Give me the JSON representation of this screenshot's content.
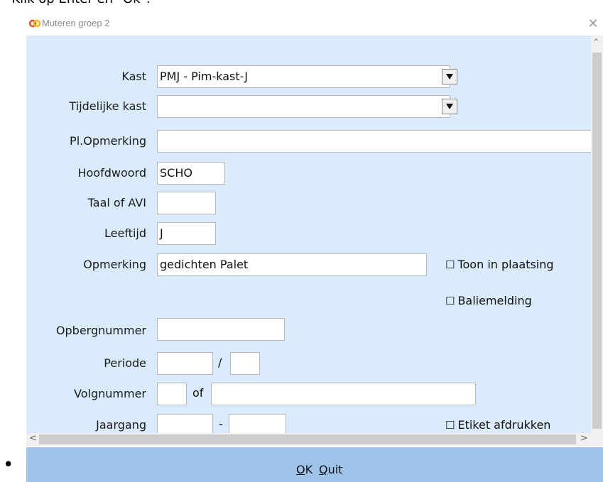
{
  "instruction": {
    "text": "Klik op Enter en \"Ok\"."
  },
  "window": {
    "title": "Muteren groep 2",
    "close_glyph": "✕"
  },
  "form": {
    "kast": {
      "label": "Kast",
      "value": "PMJ - Pim-kast-J"
    },
    "tijdelijke_kast": {
      "label": "Tijdelijke kast",
      "value": ""
    },
    "pl_opmerking": {
      "label": "Pl.Opmerking",
      "value": ""
    },
    "hoofdwoord": {
      "label": "Hoofdwoord",
      "value": "SCHO"
    },
    "taal_of_avi": {
      "label": "Taal of AVI",
      "value": ""
    },
    "leeftijd": {
      "label": "Leeftijd",
      "value": "J"
    },
    "opmerking": {
      "label": "Opmerking",
      "value": "gedichten Palet"
    },
    "toon_in_plaatsing": {
      "label": "Toon in plaatsing",
      "checked": false
    },
    "baliemelding": {
      "label": "Baliemelding",
      "checked": false
    },
    "opbergnummer": {
      "label": "Opbergnummer",
      "value": ""
    },
    "periode": {
      "label": "Periode",
      "value1": "",
      "separator": "/",
      "value2": ""
    },
    "volgnummer": {
      "label": "Volgnummer",
      "value1": "",
      "separator": "of",
      "value2": ""
    },
    "jaargang": {
      "label": "Jaargang",
      "value1": "",
      "separator": "-",
      "value2": ""
    },
    "etiket_afdrukken": {
      "label": "Etiket afdrukken",
      "checked": false
    },
    "checkbox_glyph": "☐"
  },
  "scrollbars": {
    "up": "^",
    "down": "v",
    "left": "<",
    "right": ">"
  },
  "buttons": {
    "ok": {
      "mnemonic": "O",
      "rest": "K"
    },
    "quit": {
      "mnemonic": "Q",
      "rest": "uit"
    }
  },
  "colors": {
    "form_background": "#d9ebfc",
    "button_bar": "#9fc4ea"
  }
}
